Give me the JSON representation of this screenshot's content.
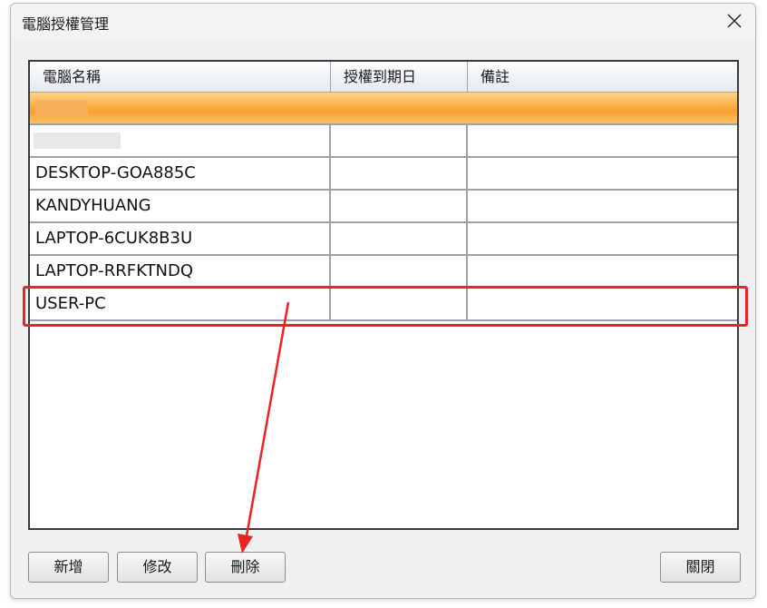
{
  "window": {
    "title": "電腦授權管理"
  },
  "grid": {
    "columns": [
      "電腦名稱",
      "授權到期日",
      "備註"
    ],
    "rows": [
      {
        "name": "",
        "expiry": "",
        "note": "",
        "selected": true,
        "obscured": true
      },
      {
        "name": "",
        "expiry": "",
        "note": "",
        "selected": false,
        "obscured": true
      },
      {
        "name": "DESKTOP-GOA885C",
        "expiry": "",
        "note": ""
      },
      {
        "name": "KANDYHUANG",
        "expiry": "",
        "note": ""
      },
      {
        "name": "LAPTOP-6CUK8B3U",
        "expiry": "",
        "note": ""
      },
      {
        "name": "LAPTOP-RRFKTNDQ",
        "expiry": "",
        "note": ""
      },
      {
        "name": "USER-PC",
        "expiry": "",
        "note": ""
      }
    ]
  },
  "buttons": {
    "add": "新增",
    "edit": "修改",
    "delete": "刪除",
    "close": "關閉"
  },
  "colors": {
    "highlight": "#ee2222",
    "selected_row": "#f7a032"
  },
  "icons": {
    "close": "close-icon"
  }
}
